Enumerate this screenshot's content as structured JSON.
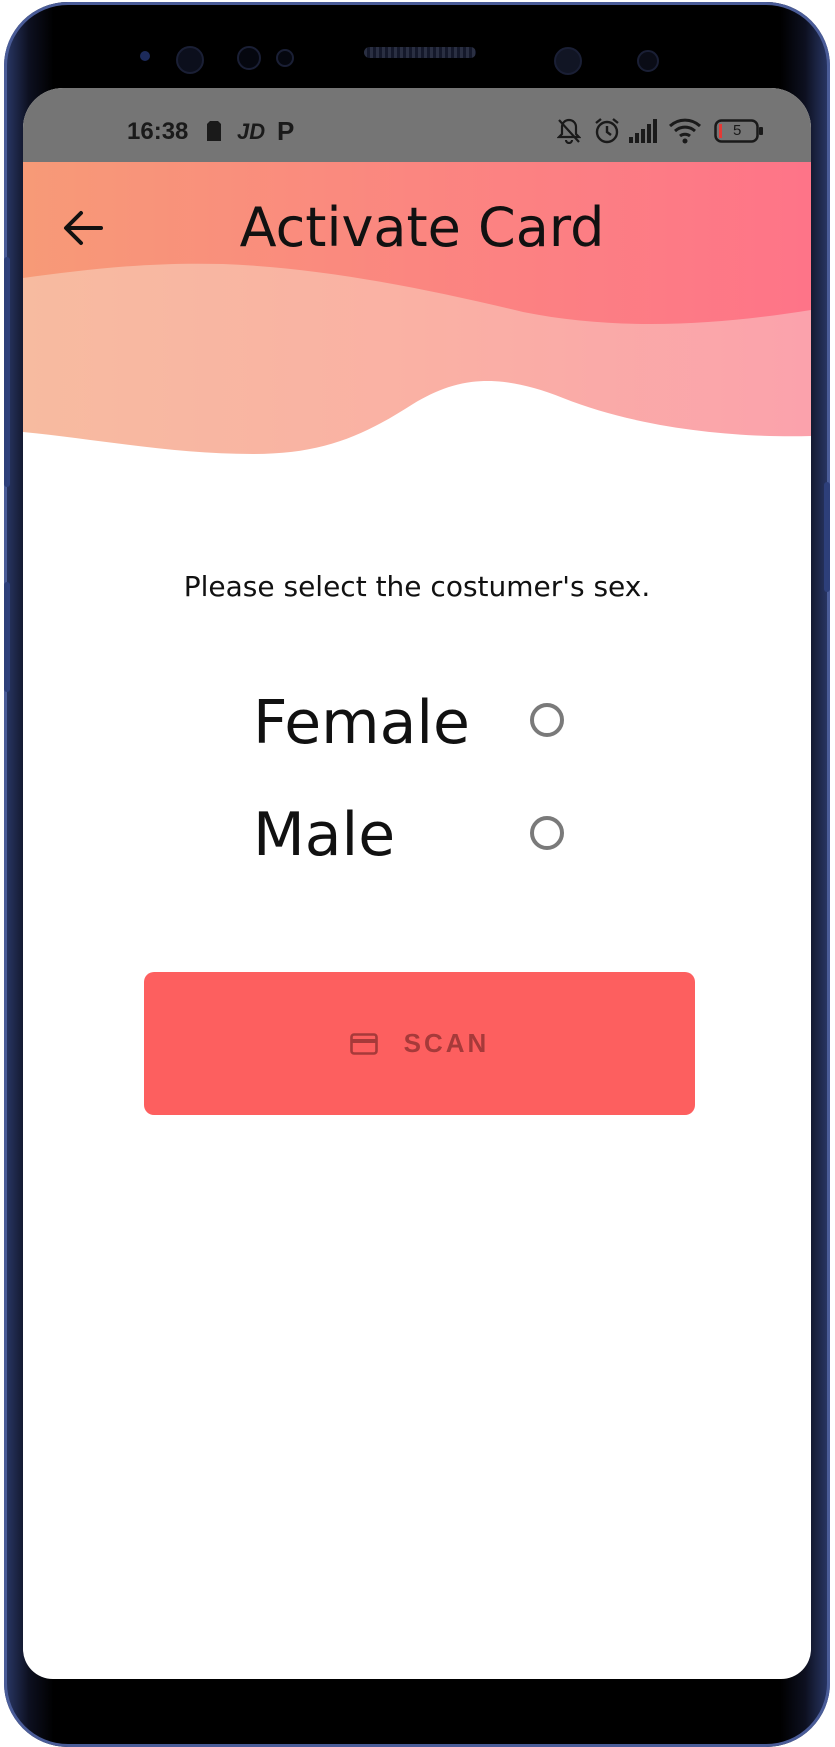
{
  "status_bar": {
    "time": "16:38",
    "left_icons": [
      "sim-icon",
      "jd-app-icon",
      "parking-app-icon"
    ],
    "right_icons": [
      "bell-off-icon",
      "alarm-icon",
      "signal-icon",
      "wifi-icon",
      "battery-icon"
    ],
    "battery_level": "5"
  },
  "app_bar": {
    "title": "Activate Card",
    "back_icon": "arrow-left-icon"
  },
  "form": {
    "prompt": "Please select the costumer's sex.",
    "options": [
      {
        "label": "Female",
        "selected": false
      },
      {
        "label": "Male",
        "selected": false
      }
    ]
  },
  "scan_button": {
    "label": "SCAN",
    "icon": "credit-card-icon"
  },
  "colors": {
    "accent": "#fd5f5f",
    "header_start": "#f89c7c",
    "header_end": "#ff7a8c",
    "status_bar": "#757575"
  }
}
